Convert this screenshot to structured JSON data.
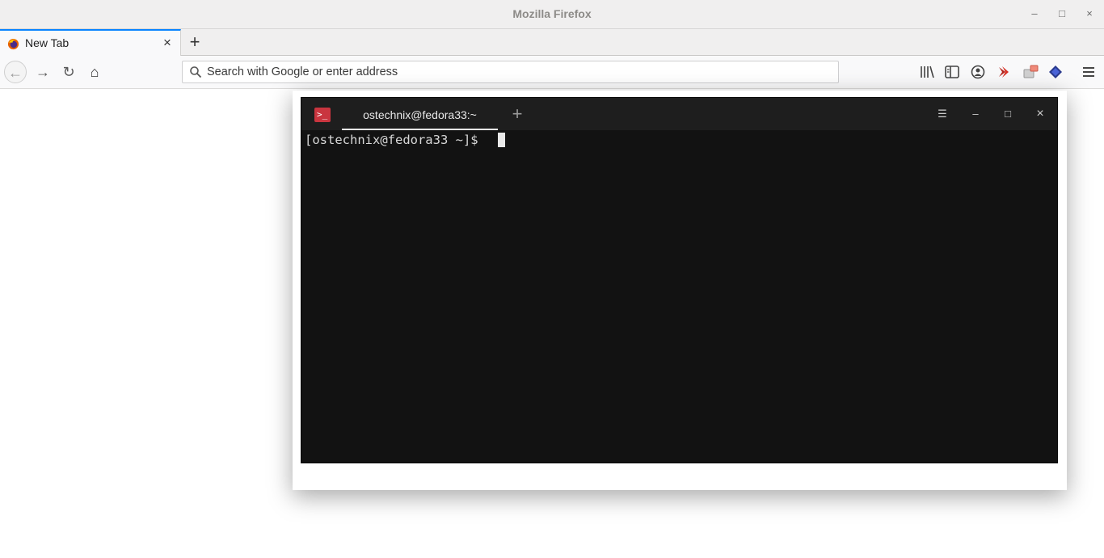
{
  "window": {
    "title": "Mozilla Firefox"
  },
  "window_controls": {
    "minimize": "–",
    "maximize": "□",
    "close": "×"
  },
  "tabs": [
    {
      "label": "New Tab",
      "close": "×"
    }
  ],
  "new_tab_label": "+",
  "nav": {
    "back": "←",
    "forward": "→",
    "reload": "↻",
    "home": "⌂",
    "url_placeholder": "Search with Google or enter address"
  },
  "toolbar_icons": [
    "library-icon",
    "sidebar-icon",
    "account-icon",
    "pocket-icon",
    "extension-icon",
    "extension-shield-icon",
    "menu-icon"
  ],
  "terminal": {
    "tab_title": "ostechnix@fedora33:~",
    "new_tab": "+",
    "controls": {
      "menu": "☰",
      "minimize": "–",
      "maximize": "□",
      "close": "×"
    },
    "prompt": "[ostechnix@fedora33 ~]$ "
  },
  "colors": {
    "accent": "#0a84ff",
    "terminal_bg": "#121212",
    "terminal_logo": "#c9353f"
  }
}
